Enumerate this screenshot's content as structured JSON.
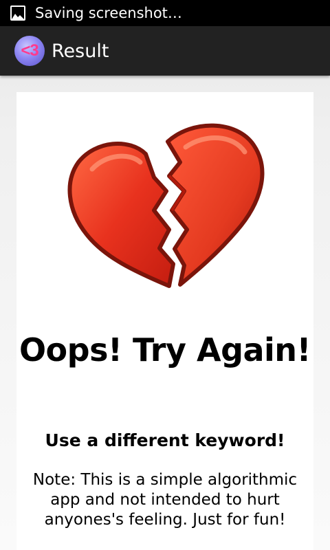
{
  "status_bar": {
    "notification_icon": "image-icon",
    "text": "Saving screenshot…"
  },
  "action_bar": {
    "app_icon_text": "<3",
    "title": "Result"
  },
  "result": {
    "image": "broken-heart-icon",
    "title": "Oops! Try Again!",
    "hint": "Use a different keyword!",
    "note": "Note: This is a simple algorithmic app and not intended to hurt anyones's feeling. Just for fun!"
  },
  "colors": {
    "status_bar_bg": "#000000",
    "action_bar_bg": "#222222",
    "heart_red": "#e8321e",
    "heart_outline": "#8a1a10",
    "app_icon_text": "#ff3b8e"
  }
}
